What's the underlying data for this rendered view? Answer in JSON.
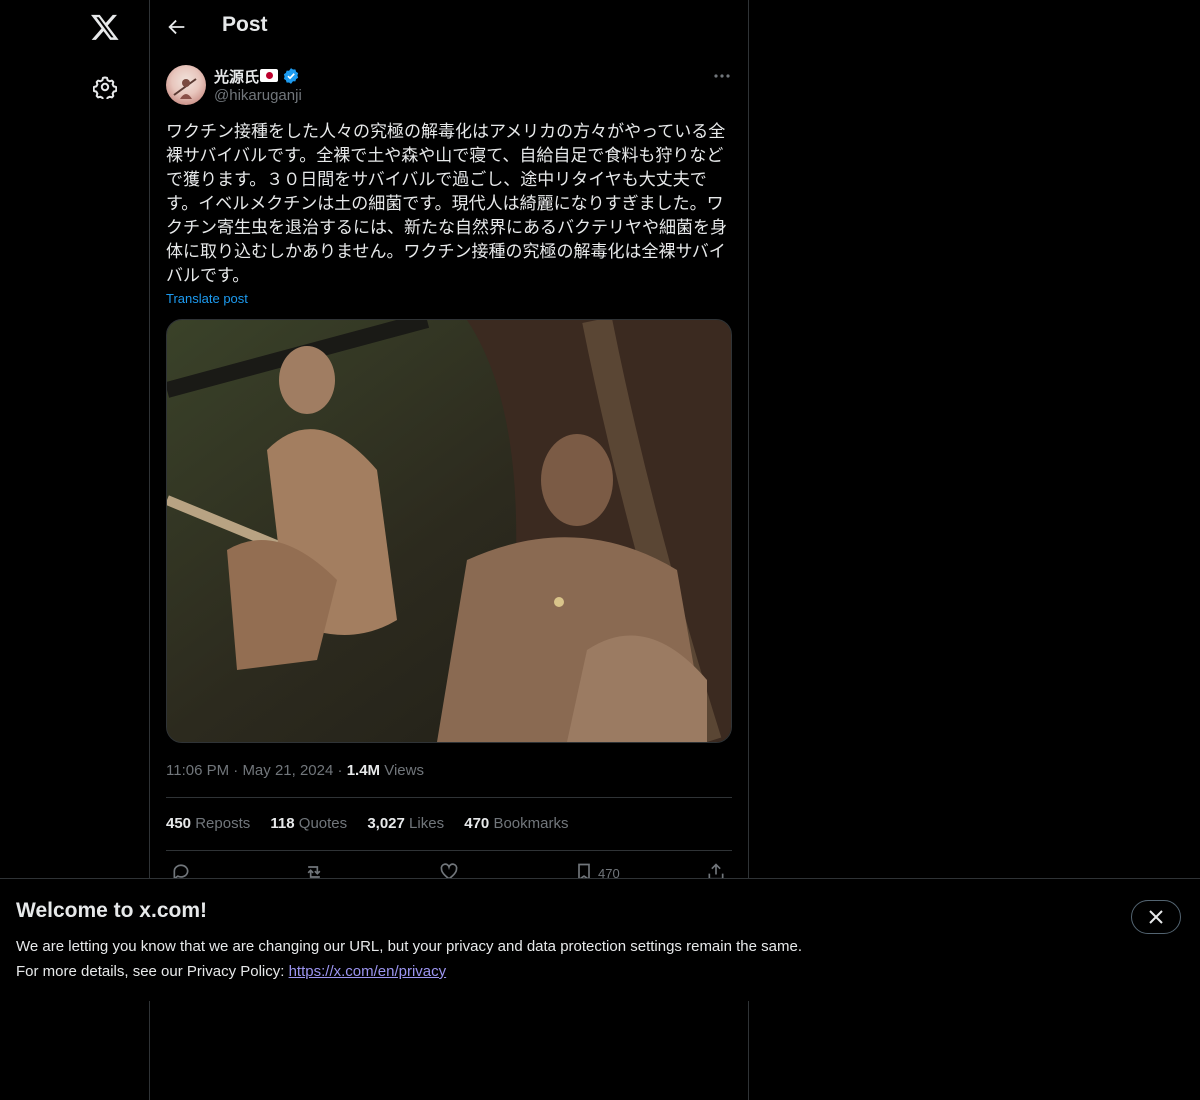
{
  "nav": {
    "logo_icon": "x-logo-icon",
    "settings_icon": "gear-icon"
  },
  "header": {
    "title": "Post",
    "back_icon": "arrow-left-icon"
  },
  "author": {
    "name": "光源氏",
    "flag": "japan-flag",
    "verified_icon": "verified-badge-icon",
    "handle": "@hikaruganji"
  },
  "post": {
    "text": "ワクチン接種をした人々の究極の解毒化はアメリカの方々がやっている全裸サバイバルです。全裸で土や森や山で寝て、自給自足で食料も狩りなどで獲ります。３０日間をサバイバルで過ごし、途中リタイヤも大丈夫です。イベルメクチンは土の細菌です。現代人は綺麗になりすぎました。ワクチン寄生虫を退治するには、新たな自然界にあるバクテリヤや細菌を身体に取り込むしかありません。ワクチン接種の究極の解毒化は全裸サバイバルです。",
    "translate_label": "Translate post",
    "time": "11:06 PM",
    "date": "May 21, 2024",
    "views_count": "1.4M",
    "views_label": "Views"
  },
  "stats": {
    "reposts_count": "450",
    "reposts_label": "Reposts",
    "quotes_count": "118",
    "quotes_label": "Quotes",
    "likes_count": "3,027",
    "likes_label": "Likes",
    "bookmarks_count": "470",
    "bookmarks_label": "Bookmarks"
  },
  "actions": {
    "bookmark_count": "470"
  },
  "banner": {
    "title": "Welcome to x.com!",
    "line1": "We are letting you know that we are changing our URL, but your privacy and data protection settings remain the same.",
    "line2_prefix": "For more details, see our Privacy Policy: ",
    "link": "https://x.com/en/privacy"
  }
}
